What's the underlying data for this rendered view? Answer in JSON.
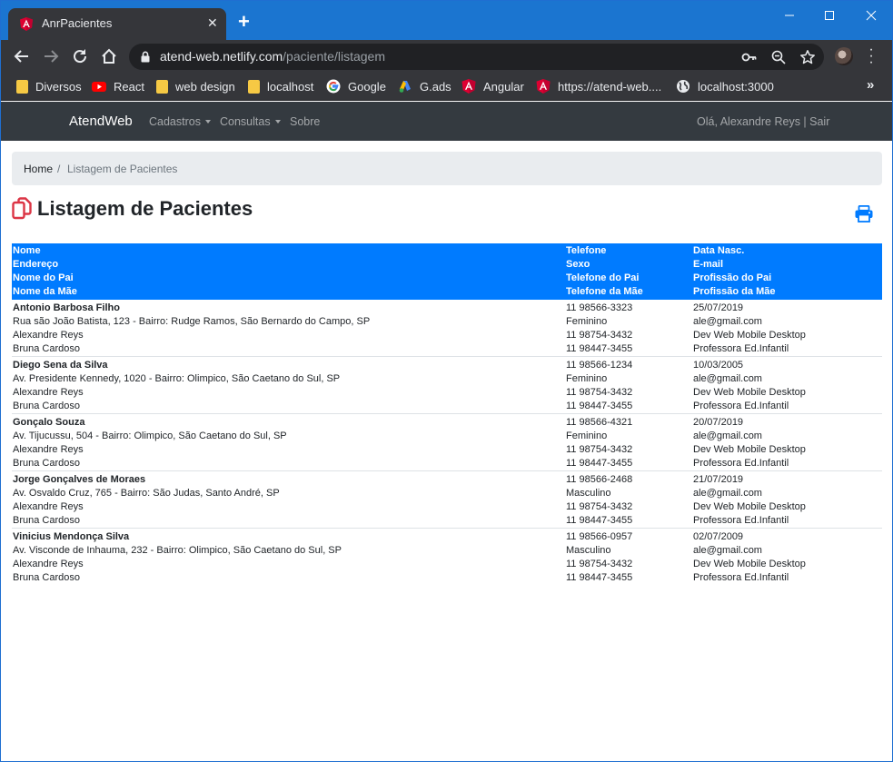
{
  "browser": {
    "tab_title": "AnrPacientes",
    "url_host": "atend-web.netlify.com",
    "url_path": "/paciente/listagem",
    "bookmarks": [
      {
        "label": "Diversos",
        "icon": "folder-icon"
      },
      {
        "label": "React",
        "icon": "youtube-icon"
      },
      {
        "label": "web design",
        "icon": "folder-icon"
      },
      {
        "label": "localhost",
        "icon": "folder-icon"
      },
      {
        "label": "Google",
        "icon": "google-icon"
      },
      {
        "label": "G.ads",
        "icon": "google-ads-icon"
      },
      {
        "label": "Angular",
        "icon": "angular-icon"
      },
      {
        "label": "https://atend-web....",
        "icon": "angular-icon"
      },
      {
        "label": "localhost:3000",
        "icon": "globe-icon"
      }
    ]
  },
  "app": {
    "brand": "AtendWeb",
    "nav": {
      "cadastros": "Cadastros",
      "consultas": "Consultas",
      "sobre": "Sobre"
    },
    "user_greeting": "Olá, Alexandre Reys | Sair",
    "breadcrumb": {
      "home": "Home",
      "separator": "/",
      "current": "Listagem de Pacientes"
    },
    "page_title": "Listagem de Pacientes",
    "colors": {
      "accent": "#007bff",
      "navbar": "#343a40",
      "title_icon": "#dc3545"
    },
    "table": {
      "headers": {
        "col1": [
          "Nome",
          "Endereço",
          "Nome do Pai",
          "Nome da Mãe"
        ],
        "col2": [
          "Telefone",
          "Sexo",
          "Telefone do Pai",
          "Telefone da Mãe"
        ],
        "col3": [
          "Data Nasc.",
          "E-mail",
          "Profissão do Pai",
          "Profissão da Mãe"
        ]
      },
      "rows": [
        {
          "nome": "Antonio Barbosa Filho",
          "endereco": "Rua são João Batista, 123 - Bairro: Rudge Ramos, São Bernardo do Campo, SP",
          "pai": "Alexandre Reys",
          "mae": "Bruna Cardoso",
          "telefone": "11 98566-3323",
          "sexo": "Feminino",
          "tel_pai": "11 98754-3432",
          "tel_mae": "11 98447-3455",
          "nasc": "25/07/2019",
          "email": "ale@gmail.com",
          "prof_pai": "Dev Web Mobile Desktop",
          "prof_mae": "Professora Ed.Infantil"
        },
        {
          "nome": "Diego Sena da Silva",
          "endereco": "Av. Presidente Kennedy, 1020 - Bairro: Olimpico, São Caetano do Sul, SP",
          "pai": "Alexandre Reys",
          "mae": "Bruna Cardoso",
          "telefone": "11 98566-1234",
          "sexo": "Feminino",
          "tel_pai": "11 98754-3432",
          "tel_mae": "11 98447-3455",
          "nasc": "10/03/2005",
          "email": "ale@gmail.com",
          "prof_pai": "Dev Web Mobile Desktop",
          "prof_mae": "Professora Ed.Infantil"
        },
        {
          "nome": "Gonçalo Souza",
          "endereco": "Av. Tijucussu, 504 - Bairro: Olimpico, São Caetano do Sul, SP",
          "pai": "Alexandre Reys",
          "mae": "Bruna Cardoso",
          "telefone": "11 98566-4321",
          "sexo": "Feminino",
          "tel_pai": "11 98754-3432",
          "tel_mae": "11 98447-3455",
          "nasc": "20/07/2019",
          "email": "ale@gmail.com",
          "prof_pai": "Dev Web Mobile Desktop",
          "prof_mae": "Professora Ed.Infantil"
        },
        {
          "nome": "Jorge Gonçalves de Moraes",
          "endereco": "Av. Osvaldo Cruz, 765 - Bairro: São Judas, Santo André, SP",
          "pai": "Alexandre Reys",
          "mae": "Bruna Cardoso",
          "telefone": "11 98566-2468",
          "sexo": "Masculino",
          "tel_pai": "11 98754-3432",
          "tel_mae": "11 98447-3455",
          "nasc": "21/07/2019",
          "email": "ale@gmail.com",
          "prof_pai": "Dev Web Mobile Desktop",
          "prof_mae": "Professora Ed.Infantil"
        },
        {
          "nome": "Vinicius Mendonça Silva",
          "endereco": "Av. Visconde de Inhauma, 232 - Bairro: Olimpico, São Caetano do Sul, SP",
          "pai": "Alexandre Reys",
          "mae": "Bruna Cardoso",
          "telefone": "11 98566-0957",
          "sexo": "Masculino",
          "tel_pai": "11 98754-3432",
          "tel_mae": "11 98447-3455",
          "nasc": "02/07/2009",
          "email": "ale@gmail.com",
          "prof_pai": "Dev Web Mobile Desktop",
          "prof_mae": "Professora Ed.Infantil"
        }
      ]
    }
  }
}
